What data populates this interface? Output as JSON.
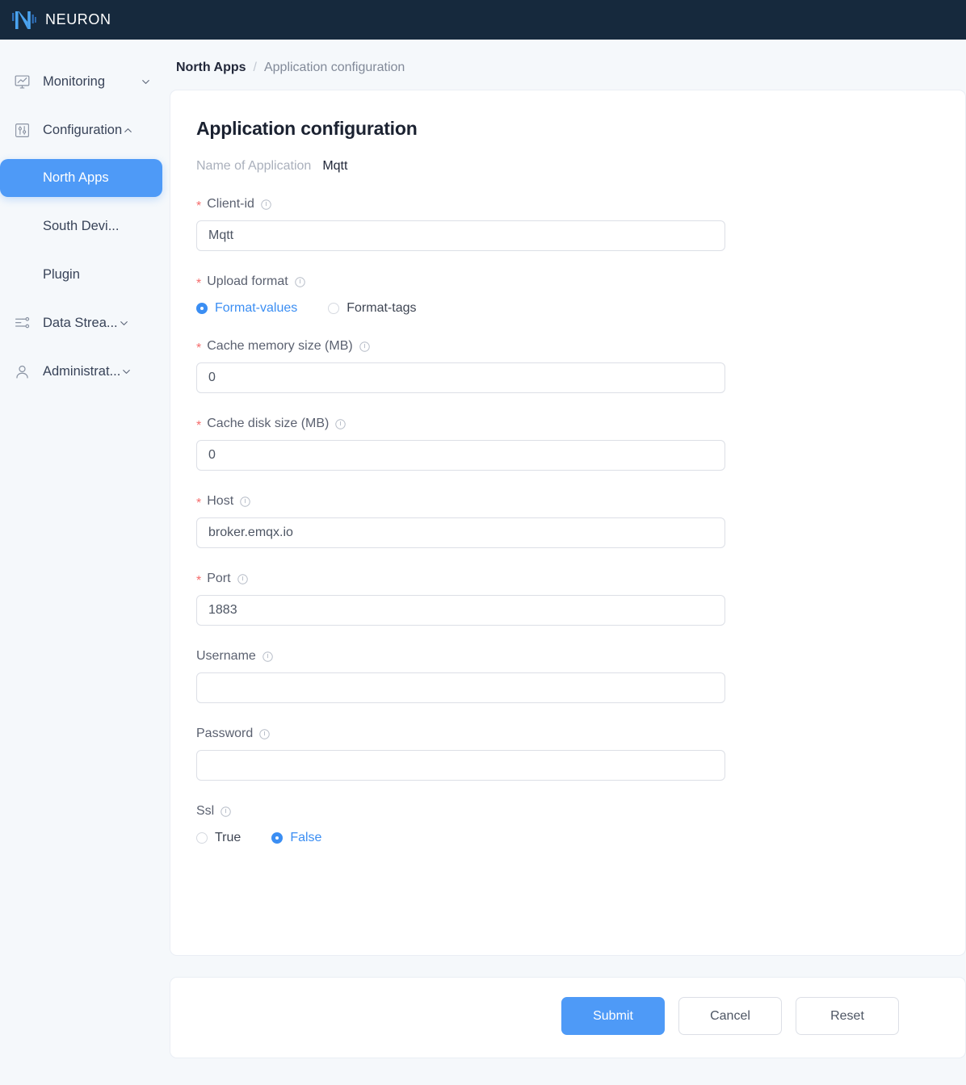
{
  "header": {
    "brand": "NEURON",
    "logo_icon": "neuron-n-logo",
    "background": "#16293d"
  },
  "sidebar": {
    "items": [
      {
        "label": "Monitoring",
        "icon": "monitor-chart-icon",
        "caret": "chevron-down-icon",
        "expanded": false
      },
      {
        "label": "Configuration",
        "icon": "sliders-box-icon",
        "caret": "chevron-up-icon",
        "expanded": true
      },
      {
        "label": "Data Strea...",
        "icon": "data-flow-icon",
        "caret": "chevron-down-icon",
        "expanded": false
      },
      {
        "label": "Administrat...",
        "icon": "user-icon",
        "caret": "chevron-down-icon",
        "expanded": false
      }
    ],
    "sub_items": [
      {
        "label": "North Apps",
        "active": true
      },
      {
        "label": "South Devi...",
        "active": false
      },
      {
        "label": "Plugin",
        "active": false
      }
    ],
    "active_color": "#4e9af7"
  },
  "breadcrumb": {
    "parent": "North Apps",
    "separator": "/",
    "current": "Application configuration"
  },
  "form": {
    "title": "Application configuration",
    "app_name_label": "Name of Application",
    "app_name_value": "Mqtt",
    "info_icon": "info-circle-icon",
    "required_marker": "*",
    "fields": [
      {
        "name": "client-id",
        "label": "Client-id",
        "required": true,
        "type": "text",
        "value": "Mqtt",
        "placeholder": ""
      },
      {
        "name": "upload-format",
        "label": "Upload format",
        "required": true,
        "type": "radio",
        "options": [
          {
            "label": "Format-values",
            "selected": true
          },
          {
            "label": "Format-tags",
            "selected": false
          }
        ]
      },
      {
        "name": "cache-memory-size",
        "label": "Cache memory size (MB)",
        "required": true,
        "type": "text",
        "value": "0",
        "placeholder": ""
      },
      {
        "name": "cache-disk-size",
        "label": "Cache disk size (MB)",
        "required": true,
        "type": "text",
        "value": "0",
        "placeholder": ""
      },
      {
        "name": "host",
        "label": "Host",
        "required": true,
        "type": "text",
        "value": "broker.emqx.io",
        "placeholder": ""
      },
      {
        "name": "port",
        "label": "Port",
        "required": true,
        "type": "text",
        "value": "1883",
        "placeholder": ""
      },
      {
        "name": "username",
        "label": "Username",
        "required": false,
        "type": "text",
        "value": "",
        "placeholder": ""
      },
      {
        "name": "password",
        "label": "Password",
        "required": false,
        "type": "password",
        "value": "",
        "placeholder": ""
      },
      {
        "name": "ssl",
        "label": "Ssl",
        "required": false,
        "type": "radio",
        "options": [
          {
            "label": "True",
            "selected": false
          },
          {
            "label": "False",
            "selected": true
          }
        ]
      }
    ]
  },
  "actions": {
    "submit": "Submit",
    "cancel": "Cancel",
    "reset": "Reset",
    "primary_color": "#4e9af7"
  }
}
